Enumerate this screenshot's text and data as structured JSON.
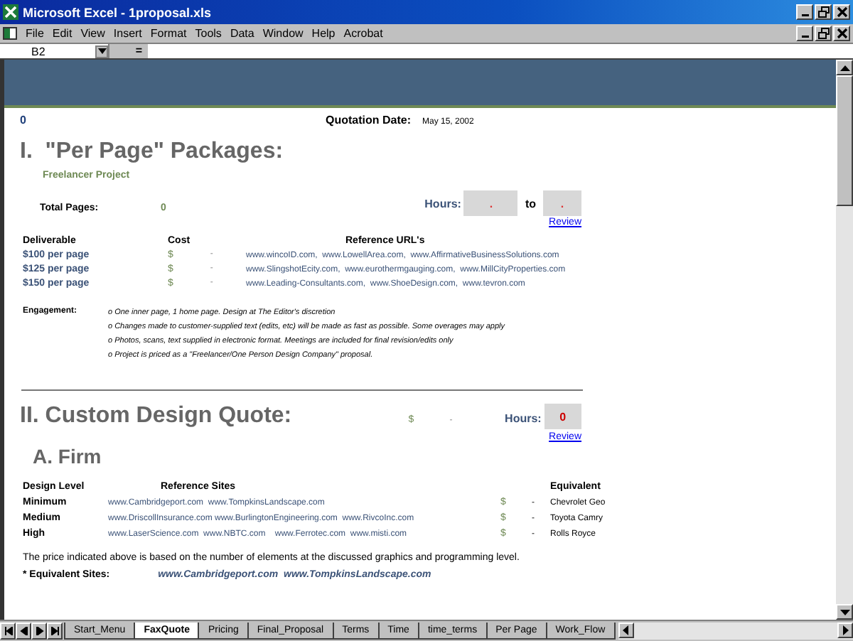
{
  "window": {
    "title": "Microsoft Excel - 1proposal.xls"
  },
  "menu": [
    "File",
    "Edit",
    "View",
    "Insert",
    "Format",
    "Tools",
    "Data",
    "Window",
    "Help",
    "Acrobat"
  ],
  "formula_bar": {
    "name_box": "B2",
    "equals": "="
  },
  "sheet": {
    "number": "0",
    "quotation_label": "Quotation Date:",
    "quotation_date": "May 15, 2002",
    "section_1": {
      "title": "I.  \"Per Page\" Packages:",
      "subtitle": "Freelancer Project",
      "hours_label": "Hours:",
      "hours_from": ".",
      "hours_sep": "to",
      "hours_to": ".",
      "review": "Review",
      "total_label": "Total Pages:",
      "total_value": "0",
      "columns": [
        "Deliverable",
        "Cost",
        "Reference URL's"
      ],
      "rows": [
        {
          "deliverable": "$100 per page",
          "currency": "$",
          "cost": "-",
          "urls": "www.wincoID.com,  www.LowellArea.com,  www.AffirmativeBusinessSolutions.com"
        },
        {
          "deliverable": "$125 per page",
          "currency": "$",
          "cost": "-",
          "urls": "www.SlingshotEcity.com,  www.eurothermgauging.com,  www.MillCityProperties.com"
        },
        {
          "deliverable": "$150 per page",
          "currency": "$",
          "cost": "-",
          "urls": "www.Leading-Consultants.com,  www.ShoeDesign.com,  www.tevron.com"
        }
      ],
      "engagement_label": "Engagement:",
      "engagement": [
        "o One inner page, 1 home page. Design at The Editor's discretion",
        "o Changes made to customer-supplied text (edits, etc) will be made as fast as possible. Some overages may apply",
        "o Photos, scans, text supplied in electronic format. Meetings are included for final revision/edits only",
        "o Project is priced as a \"Freelancer/One Person Design Company\" proposal."
      ]
    },
    "section_2": {
      "title": "II. Custom Design Quote:",
      "currency": "$",
      "cost": "-",
      "hours_label": "Hours:",
      "hours_value": "0",
      "review": "Review",
      "subtitle": "A. Firm",
      "columns": [
        "Design Level",
        "Reference Sites",
        "Equivalent"
      ],
      "rows": [
        {
          "level": "Minimum",
          "sites": "www.Cambridgeport.com  www.TompkinsLandscape.com",
          "currency": "$",
          "cost": "-",
          "equivalent": "Chevrolet Geo"
        },
        {
          "level": "Medium",
          "sites": "www.DriscollInsurance.com www.BurlingtonEngineering.com  www.RivcoInc.com",
          "currency": "$",
          "cost": "-",
          "equivalent": "Toyota Camry"
        },
        {
          "level": "High",
          "sites": "www.LaserScience.com  www.NBTC.com    www.Ferrotec.com  www.misti.com",
          "currency": "$",
          "cost": "-",
          "equivalent": "Rolls Royce"
        }
      ],
      "note": "The price indicated above is based on the number of elements at the discussed graphics and programming level.",
      "equivalent_label": "* Equivalent Sites:",
      "equivalent_sites": "www.Cambridgeport.com  www.TompkinsLandscape.com"
    }
  },
  "tabs": [
    {
      "label": "Start_Menu",
      "selected": false
    },
    {
      "label": "FaxQuote",
      "selected": true
    },
    {
      "label": "Pricing",
      "selected": false
    },
    {
      "label": "Final_Proposal",
      "selected": false
    },
    {
      "label": "Terms",
      "selected": false
    },
    {
      "label": "Time",
      "selected": false
    },
    {
      "label": "time_terms",
      "selected": false
    },
    {
      "label": "Per Page",
      "selected": false
    },
    {
      "label": "Work_Flow",
      "selected": false
    }
  ]
}
